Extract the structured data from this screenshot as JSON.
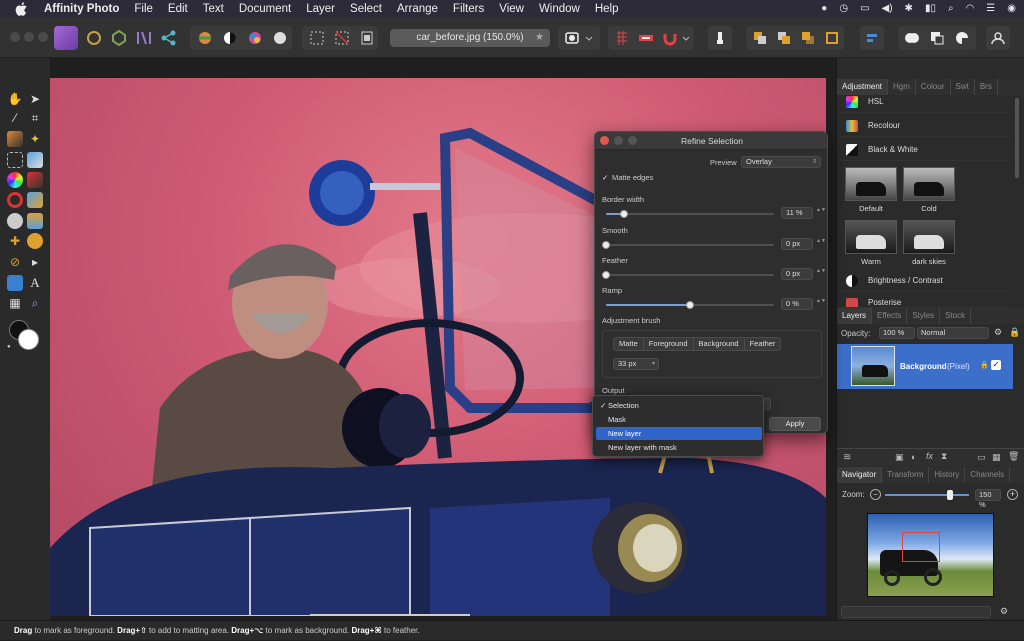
{
  "menubar": {
    "app": "Affinity Photo",
    "items": [
      "File",
      "Edit",
      "Text",
      "Document",
      "Layer",
      "Select",
      "Arrange",
      "Filters",
      "View",
      "Window",
      "Help"
    ]
  },
  "toolbar": {
    "document_title": "car_before.jpg (150.0%)",
    "star": "★"
  },
  "panels": {
    "adjustment": {
      "tabs": [
        "Adjustment",
        "Hgm",
        "Colour",
        "Swt",
        "Brs"
      ],
      "items": [
        "HSL",
        "Recolour",
        "Black & White",
        "Brightness / Contrast",
        "Posterise"
      ],
      "presets": [
        "Default",
        "Cold",
        "Warm",
        "dark skies"
      ]
    },
    "layers": {
      "tabs": [
        "Layers",
        "Effects",
        "Styles",
        "Stock"
      ],
      "opacity_label": "Opacity:",
      "opacity_value": "100 %",
      "blend_mode": "Normal",
      "layer_name": "Background",
      "layer_type": "(Pixel)"
    },
    "navigator": {
      "tabs": [
        "Navigator",
        "Transform",
        "History",
        "Channels"
      ],
      "zoom_label": "Zoom:",
      "zoom_value": "150 %",
      "zoom_minus": "−",
      "zoom_plus": "+"
    }
  },
  "dialog": {
    "title": "Refine Selection",
    "preview_label": "Preview",
    "preview_value": "Overlay",
    "matte_edges_label": "Matte edges",
    "matte_edges_checked": true,
    "sliders": [
      {
        "label": "Border width",
        "value": "11 %",
        "level": 0.11
      },
      {
        "label": "Smooth",
        "value": "0 px",
        "level": 0
      },
      {
        "label": "Feather",
        "value": "0 px",
        "level": 0
      },
      {
        "label": "Ramp",
        "value": "0 %",
        "level": 0.5
      }
    ],
    "brush_label": "Adjustment brush",
    "brush_modes": [
      "Matte",
      "Foreground",
      "Background",
      "Feather"
    ],
    "brush_size": "33 px",
    "output_label": "Output",
    "apply_label": "Apply"
  },
  "dropdown": {
    "items": [
      "Selection",
      "Mask",
      "New layer",
      "New layer with mask"
    ],
    "checked": "Selection",
    "highlighted": "New layer"
  },
  "statusbar": {
    "parts": [
      {
        "bold": "Drag",
        "text": " to mark as foreground. "
      },
      {
        "bold": "Drag+⇧",
        "text": " to add to matting area. "
      },
      {
        "bold": "Drag+⌥",
        "text": " to mark as background. "
      },
      {
        "bold": "Drag+⌘",
        "text": " to feather."
      }
    ]
  },
  "colors": {
    "overlay": "#cf5a73",
    "highlight": "#2f65c8",
    "accent": "#7aa0d8"
  }
}
